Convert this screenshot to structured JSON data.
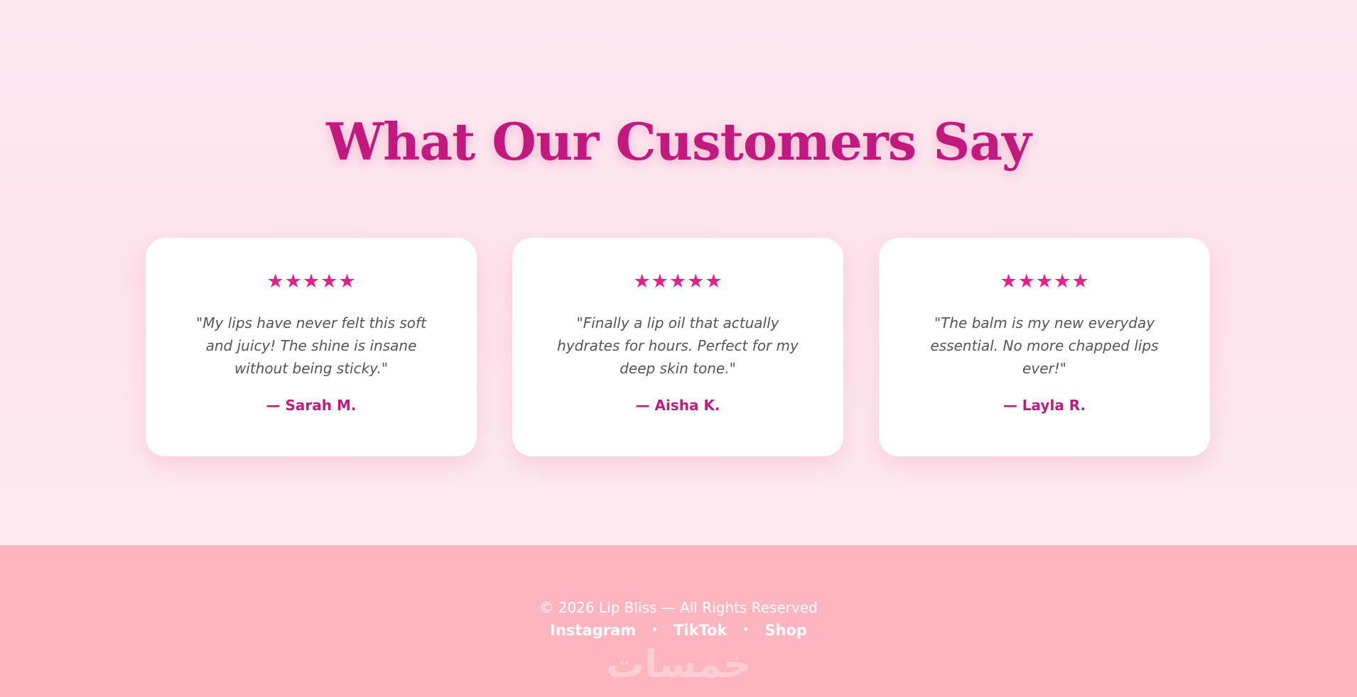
{
  "testimonials": {
    "title": "What Our Customers Say",
    "cards": [
      {
        "stars": [
          "★",
          "★",
          "★",
          "★",
          "★"
        ],
        "quote": "\"My lips have never felt this soft and juicy! The shine is insane without being sticky.\"",
        "author": "— Sarah M."
      },
      {
        "stars": [
          "★",
          "★",
          "★",
          "★",
          "★"
        ],
        "quote": "\"Finally a lip oil that actually hydrates for hours. Perfect for my deep skin tone.\"",
        "author": "— Aisha K."
      },
      {
        "stars": [
          "★",
          "★",
          "★",
          "★",
          "★"
        ],
        "quote": "\"The balm is my new everyday essential. No more chapped lips ever!\"",
        "author": "— Layla R."
      }
    ]
  },
  "footer": {
    "copyright": "© 2026 Lip Bliss — All Rights Reserved",
    "links": [
      "Instagram",
      "TikTok",
      "Shop"
    ],
    "separator": "•",
    "watermark": "خمسات"
  },
  "colors": {
    "accent": "#c2197e",
    "star": "#e91e8c",
    "footer_bg": "#ffb5c0",
    "page_bg": "#fde6ee"
  },
  "icons": {
    "star": "star-icon"
  }
}
